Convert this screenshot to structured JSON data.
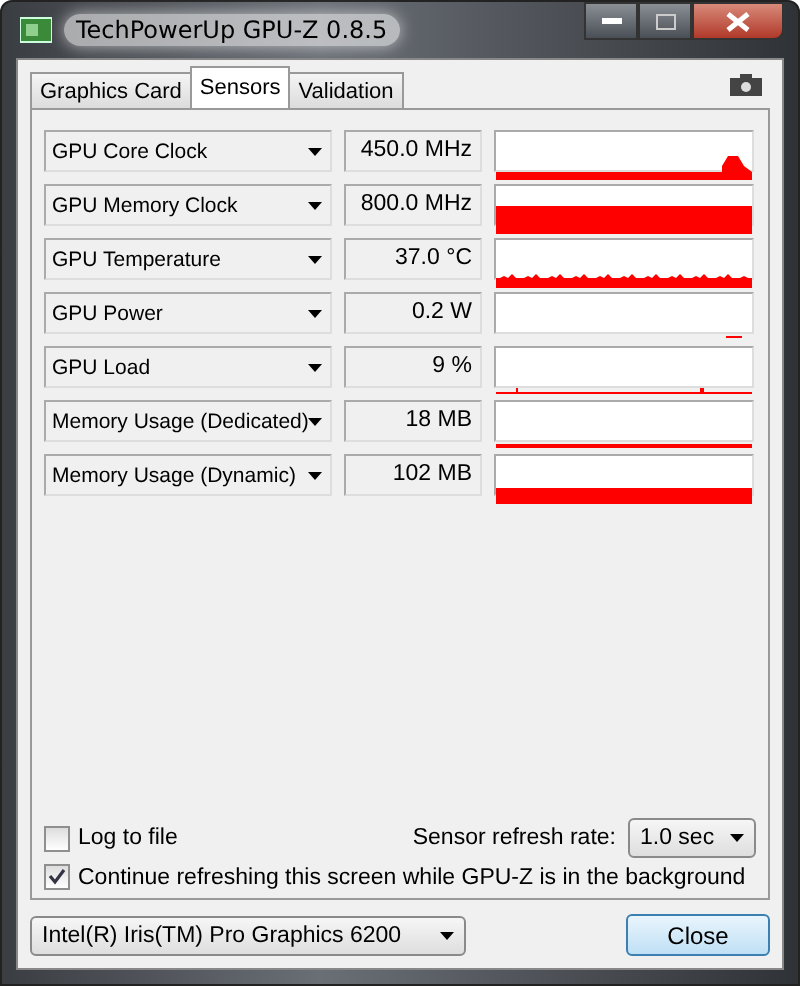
{
  "window": {
    "title": "TechPowerUp GPU-Z 0.8.5"
  },
  "tabs": [
    {
      "label": "Graphics Card",
      "selected": false
    },
    {
      "label": "Sensors",
      "selected": true
    },
    {
      "label": "Validation",
      "selected": false
    }
  ],
  "sensors": [
    {
      "name": "GPU Core Clock",
      "reading": "450.0 MHz"
    },
    {
      "name": "GPU Memory Clock",
      "reading": "800.0 MHz"
    },
    {
      "name": "GPU Temperature",
      "reading": "37.0 °C"
    },
    {
      "name": "GPU Power",
      "reading": "0.2 W"
    },
    {
      "name": "GPU Load",
      "reading": "9 %"
    },
    {
      "name": "Memory Usage (Dedicated)",
      "reading": "18 MB"
    },
    {
      "name": "Memory Usage (Dynamic)",
      "reading": "102 MB"
    }
  ],
  "log_to_file": {
    "label": "Log to file",
    "checked": false
  },
  "refresh_rate": {
    "label": "Sensor refresh rate:",
    "value": "1.0 sec"
  },
  "continue_refreshing": {
    "label": "Continue refreshing this screen while GPU-Z is in the background",
    "checked": true
  },
  "device": {
    "value": "Intel(R) Iris(TM) Pro Graphics 6200"
  },
  "close_button": {
    "label": "Close"
  }
}
